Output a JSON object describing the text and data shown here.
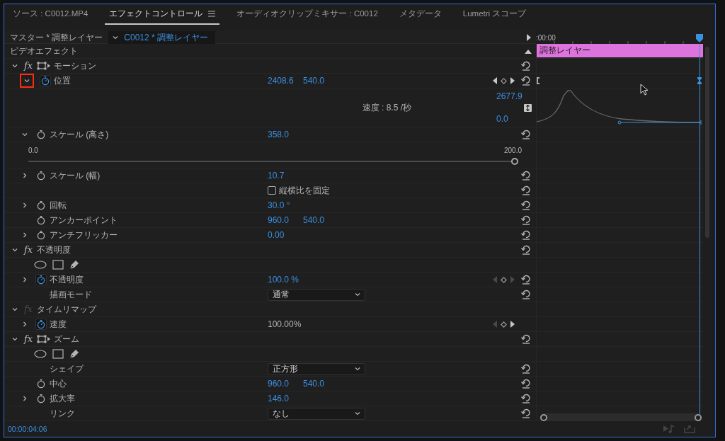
{
  "tabs": [
    {
      "label": "ソース : C0012.MP4",
      "selected": false
    },
    {
      "label": "エフェクトコントロール",
      "selected": true
    },
    {
      "label": "オーディオクリップミキサー : C0012",
      "selected": false
    },
    {
      "label": "メタデータ",
      "selected": false
    },
    {
      "label": "Lumetri スコープ",
      "selected": false
    }
  ],
  "header": {
    "master_label": "マスター * 調整レイヤー",
    "clip_selector": "C0012 * 調整レイヤー",
    "ruler_start": ":00:00"
  },
  "rows": [
    {
      "kind": "section",
      "label": "ビデオエフェクト",
      "clip_label": "調整レイヤー"
    },
    {
      "kind": "effect",
      "fx": "fx",
      "fx_enabled": true,
      "transform_handle": true,
      "label": "モーション",
      "expanded": true,
      "reset": true
    },
    {
      "kind": "property",
      "label": "位置",
      "expanded": true,
      "highlighted": true,
      "animated": true,
      "scrubbable": true,
      "values": [
        "2408.6",
        "540.0"
      ],
      "keyframe_nav": {
        "prev_enabled": true,
        "next_enabled": true
      },
      "keyframe_range": true,
      "reset": true
    },
    {
      "kind": "graph",
      "speed_text": "速度 : 8.5 /秒",
      "max": "2677.9",
      "min": "0.0"
    },
    {
      "kind": "property",
      "label": "スケール (高さ)",
      "expanded": true,
      "highlighted": false,
      "animated": false,
      "scrubbable": true,
      "values": [
        "358.0"
      ],
      "reset": true
    },
    {
      "kind": "slider",
      "min_label": "0.0",
      "max_label": "200.0",
      "level": 1
    },
    {
      "kind": "property",
      "label": "スケール (幅)",
      "expanded": false,
      "highlighted": false,
      "animated": false,
      "scrubbable": true,
      "values": [
        "10.7"
      ],
      "reset": true
    },
    {
      "kind": "checkbox",
      "label": "縦横比を固定",
      "checked": false,
      "reset": true
    },
    {
      "kind": "property",
      "label": "回転",
      "expanded": false,
      "highlighted": false,
      "animated": false,
      "scrubbable": true,
      "values": [
        "30.0 °"
      ],
      "reset": true
    },
    {
      "kind": "property",
      "label": "アンカーポイント",
      "animated": false,
      "scrubbable": true,
      "values": [
        "960.0",
        "540.0"
      ],
      "reset": true
    },
    {
      "kind": "property",
      "label": "アンチフリッカー",
      "expanded": false,
      "highlighted": false,
      "animated": false,
      "scrubbable": true,
      "values": [
        "0.00"
      ],
      "reset": true
    },
    {
      "kind": "effect",
      "fx": "fx",
      "fx_enabled": true,
      "transform_handle": false,
      "label": "不透明度",
      "expanded": true,
      "reset": true
    },
    {
      "kind": "masks"
    },
    {
      "kind": "property",
      "label": "不透明度",
      "expanded": false,
      "highlighted": false,
      "animated": true,
      "scrubbable": true,
      "values": [
        "100.0 %"
      ],
      "keyframe_nav": {
        "prev_enabled": false,
        "next_enabled": false
      },
      "reset": true
    },
    {
      "kind": "dropdown",
      "label": "描画モード",
      "value": "通常",
      "reset": true
    },
    {
      "kind": "effect",
      "fx": "fx",
      "fx_enabled": false,
      "transform_handle": false,
      "label": "タイムリマップ",
      "expanded": true,
      "reset": false
    },
    {
      "kind": "property",
      "label": "速度",
      "expanded": false,
      "highlighted": false,
      "animated": true,
      "scrubbable": false,
      "values": [
        "100.00%"
      ],
      "keyframe_nav": {
        "prev_enabled": false,
        "next_enabled": true
      },
      "reset": false
    },
    {
      "kind": "effect",
      "fx": "fx",
      "fx_enabled": true,
      "transform_handle": true,
      "label": "ズーム",
      "expanded": true,
      "reset": true
    },
    {
      "kind": "masks"
    },
    {
      "kind": "dropdown",
      "label": "シェイプ",
      "value": "正方形",
      "reset": true
    },
    {
      "kind": "property",
      "label": "中心",
      "animated": false,
      "scrubbable": true,
      "values": [
        "960.0",
        "540.0"
      ],
      "reset": true
    },
    {
      "kind": "property",
      "label": "拡大率",
      "expanded": false,
      "highlighted": false,
      "animated": false,
      "scrubbable": true,
      "values": [
        "146.0"
      ],
      "reset": true
    },
    {
      "kind": "dropdown",
      "label": "リンク",
      "value": "なし",
      "reset": true
    }
  ],
  "footer": {
    "timecode": "00:00:04:06"
  }
}
